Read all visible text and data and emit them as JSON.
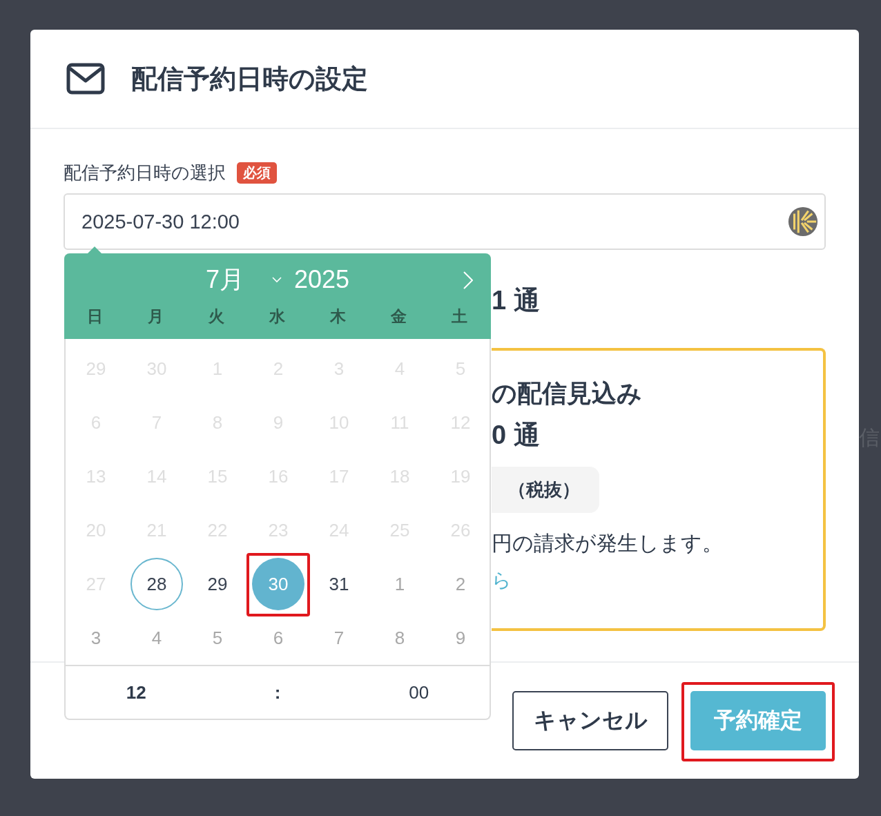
{
  "backdrop": {
    "text": "信"
  },
  "dialog": {
    "title": "配信予約日時の設定",
    "field": {
      "label": "配信予約日時の選択",
      "badge": "必須",
      "value": "2025-07-30 12:00"
    },
    "summary": {
      "count": "1 通",
      "box": {
        "heading": "の配信見込み",
        "count": "0 通",
        "price": "（税抜）",
        "note": "円の請求が発生します。",
        "link": "ら"
      }
    },
    "buttons": [
      {
        "label": "キャンセル",
        "kind": "secondary",
        "highlighted": false
      },
      {
        "label": "予約確定",
        "kind": "primary",
        "highlighted": true
      }
    ]
  },
  "datepicker": {
    "month": "7月",
    "year": "2025",
    "weekdays": [
      "日",
      "月",
      "火",
      "水",
      "木",
      "金",
      "土"
    ],
    "weeks": [
      [
        {
          "day": "29",
          "kind": "disabled",
          "today": false,
          "selected": false,
          "highlighted": false
        },
        {
          "day": "30",
          "kind": "disabled",
          "today": false,
          "selected": false,
          "highlighted": false
        },
        {
          "day": "1",
          "kind": "disabled",
          "today": false,
          "selected": false,
          "highlighted": false
        },
        {
          "day": "2",
          "kind": "disabled",
          "today": false,
          "selected": false,
          "highlighted": false
        },
        {
          "day": "3",
          "kind": "disabled",
          "today": false,
          "selected": false,
          "highlighted": false
        },
        {
          "day": "4",
          "kind": "disabled",
          "today": false,
          "selected": false,
          "highlighted": false
        },
        {
          "day": "5",
          "kind": "disabled",
          "today": false,
          "selected": false,
          "highlighted": false
        }
      ],
      [
        {
          "day": "6",
          "kind": "disabled",
          "today": false,
          "selected": false,
          "highlighted": false
        },
        {
          "day": "7",
          "kind": "disabled",
          "today": false,
          "selected": false,
          "highlighted": false
        },
        {
          "day": "8",
          "kind": "disabled",
          "today": false,
          "selected": false,
          "highlighted": false
        },
        {
          "day": "9",
          "kind": "disabled",
          "today": false,
          "selected": false,
          "highlighted": false
        },
        {
          "day": "10",
          "kind": "disabled",
          "today": false,
          "selected": false,
          "highlighted": false
        },
        {
          "day": "11",
          "kind": "disabled",
          "today": false,
          "selected": false,
          "highlighted": false
        },
        {
          "day": "12",
          "kind": "disabled",
          "today": false,
          "selected": false,
          "highlighted": false
        }
      ],
      [
        {
          "day": "13",
          "kind": "disabled",
          "today": false,
          "selected": false,
          "highlighted": false
        },
        {
          "day": "14",
          "kind": "disabled",
          "today": false,
          "selected": false,
          "highlighted": false
        },
        {
          "day": "15",
          "kind": "disabled",
          "today": false,
          "selected": false,
          "highlighted": false
        },
        {
          "day": "16",
          "kind": "disabled",
          "today": false,
          "selected": false,
          "highlighted": false
        },
        {
          "day": "17",
          "kind": "disabled",
          "today": false,
          "selected": false,
          "highlighted": false
        },
        {
          "day": "18",
          "kind": "disabled",
          "today": false,
          "selected": false,
          "highlighted": false
        },
        {
          "day": "19",
          "kind": "disabled",
          "today": false,
          "selected": false,
          "highlighted": false
        }
      ],
      [
        {
          "day": "20",
          "kind": "disabled",
          "today": false,
          "selected": false,
          "highlighted": false
        },
        {
          "day": "21",
          "kind": "disabled",
          "today": false,
          "selected": false,
          "highlighted": false
        },
        {
          "day": "22",
          "kind": "disabled",
          "today": false,
          "selected": false,
          "highlighted": false
        },
        {
          "day": "23",
          "kind": "disabled",
          "today": false,
          "selected": false,
          "highlighted": false
        },
        {
          "day": "24",
          "kind": "disabled",
          "today": false,
          "selected": false,
          "highlighted": false
        },
        {
          "day": "25",
          "kind": "disabled",
          "today": false,
          "selected": false,
          "highlighted": false
        },
        {
          "day": "26",
          "kind": "disabled",
          "today": false,
          "selected": false,
          "highlighted": false
        }
      ],
      [
        {
          "day": "27",
          "kind": "disabled",
          "today": false,
          "selected": false,
          "highlighted": false
        },
        {
          "day": "28",
          "kind": "current",
          "today": true,
          "selected": false,
          "highlighted": false
        },
        {
          "day": "29",
          "kind": "current",
          "today": false,
          "selected": false,
          "highlighted": false
        },
        {
          "day": "30",
          "kind": "current",
          "today": false,
          "selected": true,
          "highlighted": true
        },
        {
          "day": "31",
          "kind": "current",
          "today": false,
          "selected": false,
          "highlighted": false
        },
        {
          "day": "1",
          "kind": "outside",
          "today": false,
          "selected": false,
          "highlighted": false
        },
        {
          "day": "2",
          "kind": "outside",
          "today": false,
          "selected": false,
          "highlighted": false
        }
      ],
      [
        {
          "day": "3",
          "kind": "outside",
          "today": false,
          "selected": false,
          "highlighted": false
        },
        {
          "day": "4",
          "kind": "outside",
          "today": false,
          "selected": false,
          "highlighted": false
        },
        {
          "day": "5",
          "kind": "outside",
          "today": false,
          "selected": false,
          "highlighted": false
        },
        {
          "day": "6",
          "kind": "outside",
          "today": false,
          "selected": false,
          "highlighted": false
        },
        {
          "day": "7",
          "kind": "outside",
          "today": false,
          "selected": false,
          "highlighted": false
        },
        {
          "day": "8",
          "kind": "outside",
          "today": false,
          "selected": false,
          "highlighted": false
        },
        {
          "day": "9",
          "kind": "outside",
          "today": false,
          "selected": false,
          "highlighted": false
        }
      ]
    ],
    "time": {
      "hour": "12",
      "separator": ":",
      "minute": "00"
    }
  }
}
